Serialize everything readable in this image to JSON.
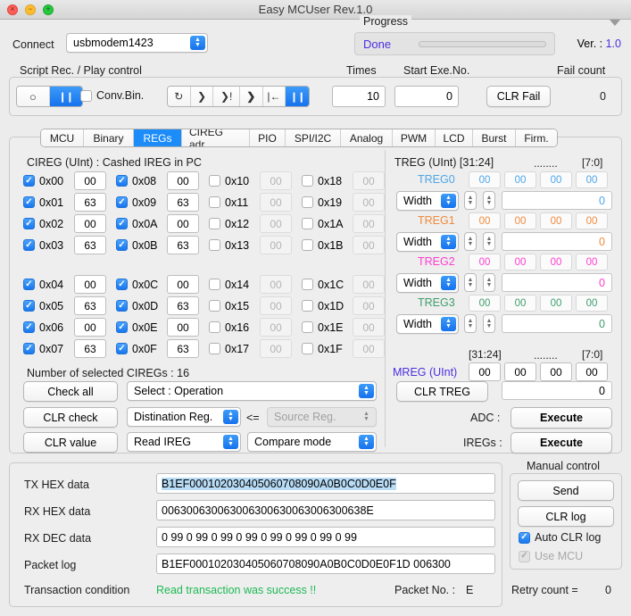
{
  "window": {
    "title": "Easy MCUser Rev.1.0",
    "traffic": [
      "close-icon",
      "minimize-icon",
      "maximize-icon"
    ]
  },
  "top": {
    "connect_label": "Connect",
    "connect_value": "usbmodem1423",
    "progress_title": "Progress",
    "progress_status": "Done",
    "ver_label": "Ver. : ",
    "ver_value": "1.0"
  },
  "script": {
    "group_title": "Script Rec. / Play control",
    "times_label": "Times",
    "start_label": "Start Exe.No.",
    "fail_label": "Fail count",
    "record_glyph": "○",
    "pause_glyph": "❙❙",
    "conv_bin_label": "Conv.Bin.",
    "conv_bin_checked": false,
    "transport": [
      "↻",
      "❯",
      "❯!",
      "❯",
      "|←",
      "❙❙"
    ],
    "times_value": "10",
    "start_value": "0",
    "clr_fail_label": "CLR Fail",
    "fail_count": "0"
  },
  "tabs": [
    {
      "label": "MCU",
      "active": false
    },
    {
      "label": "Binary",
      "active": false
    },
    {
      "label": "REGs",
      "active": true
    },
    {
      "label": "CIREG adr.",
      "active": false
    },
    {
      "label": "PIO",
      "active": false
    },
    {
      "label": "SPI/I2C",
      "active": false
    },
    {
      "label": "Analog",
      "active": false
    },
    {
      "label": "PWM",
      "active": false
    },
    {
      "label": "LCD",
      "active": false
    },
    {
      "label": "Burst",
      "active": false
    },
    {
      "label": "Firm.",
      "active": false
    }
  ],
  "cireg": {
    "title": "CIREG (UInt) : Cashed IREG in PC",
    "columns": [
      {
        "cells": [
          {
            "name": "0x00",
            "value": "00",
            "checked": true
          },
          {
            "name": "0x01",
            "value": "63",
            "checked": true
          },
          {
            "name": "0x02",
            "value": "00",
            "checked": true
          },
          {
            "name": "0x03",
            "value": "63",
            "checked": true
          },
          {
            "name": "0x04",
            "value": "00",
            "checked": true
          },
          {
            "name": "0x05",
            "value": "63",
            "checked": true
          },
          {
            "name": "0x06",
            "value": "00",
            "checked": true
          },
          {
            "name": "0x07",
            "value": "63",
            "checked": true
          }
        ]
      },
      {
        "cells": [
          {
            "name": "0x08",
            "value": "00",
            "checked": true
          },
          {
            "name": "0x09",
            "value": "63",
            "checked": true
          },
          {
            "name": "0x0A",
            "value": "00",
            "checked": true
          },
          {
            "name": "0x0B",
            "value": "63",
            "checked": true
          },
          {
            "name": "0x0C",
            "value": "00",
            "checked": true
          },
          {
            "name": "0x0D",
            "value": "63",
            "checked": true
          },
          {
            "name": "0x0E",
            "value": "00",
            "checked": true
          },
          {
            "name": "0x0F",
            "value": "63",
            "checked": true
          }
        ]
      },
      {
        "cells": [
          {
            "name": "0x10",
            "value": "00",
            "checked": false
          },
          {
            "name": "0x11",
            "value": "00",
            "checked": false
          },
          {
            "name": "0x12",
            "value": "00",
            "checked": false
          },
          {
            "name": "0x13",
            "value": "00",
            "checked": false
          },
          {
            "name": "0x14",
            "value": "00",
            "checked": false
          },
          {
            "name": "0x15",
            "value": "00",
            "checked": false
          },
          {
            "name": "0x16",
            "value": "00",
            "checked": false
          },
          {
            "name": "0x17",
            "value": "00",
            "checked": false
          }
        ]
      },
      {
        "cells": [
          {
            "name": "0x18",
            "value": "00",
            "checked": false
          },
          {
            "name": "0x19",
            "value": "00",
            "checked": false
          },
          {
            "name": "0x1A",
            "value": "00",
            "checked": false
          },
          {
            "name": "0x1B",
            "value": "00",
            "checked": false
          },
          {
            "name": "0x1C",
            "value": "00",
            "checked": false
          },
          {
            "name": "0x1D",
            "value": "00",
            "checked": false
          },
          {
            "name": "0x1E",
            "value": "00",
            "checked": false
          },
          {
            "name": "0x1F",
            "value": "00",
            "checked": false
          }
        ]
      }
    ],
    "selected_label": "Number of selected CIREGs :  16",
    "check_all": "Check all",
    "clr_check": "CLR check",
    "clr_value": "CLR value",
    "select_operation": "Select : Operation",
    "destination_reg": "Distination Reg.",
    "arrow": "<=",
    "source_reg": "Source Reg.",
    "read_ireg": "Read IREG",
    "compare_mode": "Compare mode"
  },
  "treg": {
    "title": "TREG (UInt) [31:24]",
    "dots": "........",
    "low_label": "[7:0]",
    "hi_label": "[31:24]",
    "width_label": "Width",
    "rows": [
      {
        "name": "TREG0",
        "color": "#4da6ea",
        "bytes": [
          "00",
          "00",
          "00",
          "00"
        ],
        "total": "0"
      },
      {
        "name": "TREG1",
        "color": "#f08a3c",
        "bytes": [
          "00",
          "00",
          "00",
          "00"
        ],
        "total": "0"
      },
      {
        "name": "TREG2",
        "color": "#ff3dd0",
        "bytes": [
          "00",
          "00",
          "00",
          "00"
        ],
        "total": "0"
      },
      {
        "name": "TREG3",
        "color": "#3f9e6d",
        "bytes": [
          "00",
          "00",
          "00",
          "00"
        ],
        "total": "0"
      }
    ],
    "mreg_label": "MREG (UInt)",
    "mreg_color": "#4b2fe0",
    "mreg_bytes": [
      "00",
      "00",
      "00",
      "00"
    ],
    "mreg_total": "0",
    "clr_treg": "CLR TREG",
    "adc_label": "ADC :",
    "adc_button": "Execute",
    "iregs_label": "IREGs :",
    "iregs_button": "Execute"
  },
  "bottom": {
    "tx_label": "TX HEX data",
    "tx_value": "B1EF000102030405060708090A0B0C0D0E0F",
    "rx_hex_label": "RX HEX data",
    "rx_hex_value": "006300630063006300630063006300638E",
    "rx_dec_label": "RX DEC data",
    "rx_dec_value": "0 99 0 99 0 99 0 99 0 99 0 99 0 99 0 99",
    "packet_log_label": "Packet log",
    "packet_log_value": "B1EF000102030405060708090A0B0C0D0E0F1D 006300",
    "transaction_label": "Transaction condition",
    "transaction_status": "Read transaction was success !!",
    "packet_no_label": "Packet No. :",
    "packet_no_value": "E",
    "retry_label": "Retry count  =",
    "retry_value": "0"
  },
  "manual": {
    "title": "Manual control",
    "send": "Send",
    "clr_log": "CLR log",
    "auto_clr_label": "Auto CLR log",
    "auto_clr_checked": true,
    "use_mcu_label": "Use MCU",
    "use_mcu_checked": true,
    "use_mcu_disabled": true
  },
  "colors": {
    "accent": "#1c8cf8",
    "purple": "#4b2fe0",
    "green": "#1db954"
  }
}
